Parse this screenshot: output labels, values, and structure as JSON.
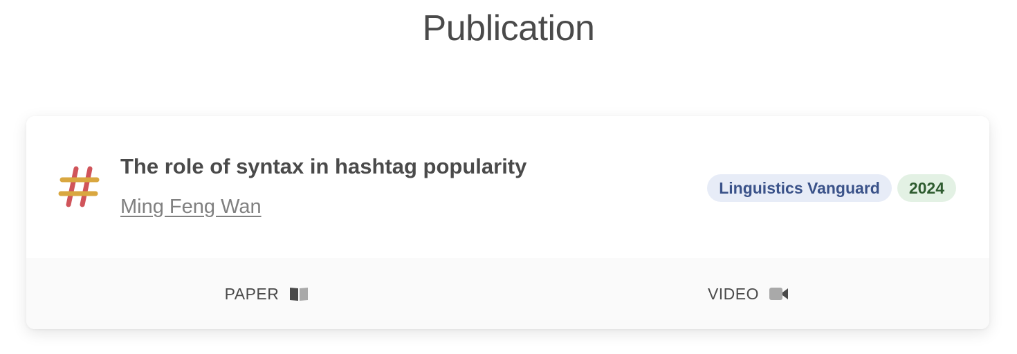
{
  "section": {
    "title": "Publication"
  },
  "publication": {
    "icon": "hashtag-icon",
    "title": "The role of syntax in hashtag popularity",
    "author": "Ming Feng Wan",
    "venue": "Linguistics Vanguard",
    "year": "2024"
  },
  "links": {
    "paper_label": "PAPER",
    "paper_icon": "book-icon",
    "video_label": "VIDEO",
    "video_icon": "video-camera-icon"
  },
  "colors": {
    "venue_tag_bg": "#e7ecf7",
    "venue_tag_text": "#3a5289",
    "year_tag_bg": "#e3f1e4",
    "year_tag_text": "#2f5c30",
    "hashtag_red": "#d0545a",
    "hashtag_yellow": "#d9a740"
  }
}
